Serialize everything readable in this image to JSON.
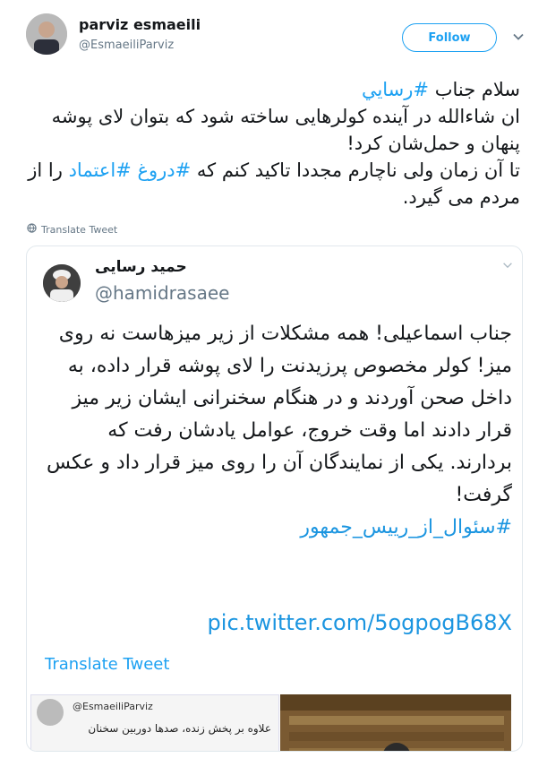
{
  "author": {
    "name": "parviz esmaeili",
    "handle": "@EsmaeiliParviz"
  },
  "follow_label": "Follow",
  "tweet": {
    "line1_prefix": "سلام جناب ",
    "hashtag1": "#رسایي",
    "line2": "ان شاءالله در آینده کولرهایی ساخته شود که بتوان لای پوشه پنهان و حمل‌شان کرد!",
    "line3_prefix": "تا آن زمان ولی ناچارم مجددا تاکید کنم که ",
    "hashtag2": "#دروغ",
    "hashtag3": "#اعتماد",
    "line3_suffix": " را از مردم می گیرد."
  },
  "translate_label": "Translate Tweet",
  "quoted": {
    "name": "حمید رسایی",
    "handle": "@hamidrasaee",
    "text": "جناب اسماعیلی! همه مشکلات از زیر میزهاست نه روی میز! کولر مخصوص پرزیدنت را لای پوشه قرار داده، به داخل صحن آوردند و در هنگام سخنرانی ایشان زیر میز قرار دادند اما وقت خروج، عوامل یادشان رفت که بردارند. یکی از نمایندگان آن را روی میز قرار داد و عکس گرفت!",
    "hashtag": "#سئوال_از_رییس_جمهور",
    "link": "pic.twitter.com/5ogpogB68X",
    "translate_label": "Translate Tweet",
    "thumb_handle": "@EsmaeiliParviz",
    "thumb_text": "علاوه بر پخش زنده، صدها دوربین سخنان"
  },
  "colors": {
    "accent": "#1da1f2",
    "muted": "#657786",
    "text": "#14171a"
  }
}
